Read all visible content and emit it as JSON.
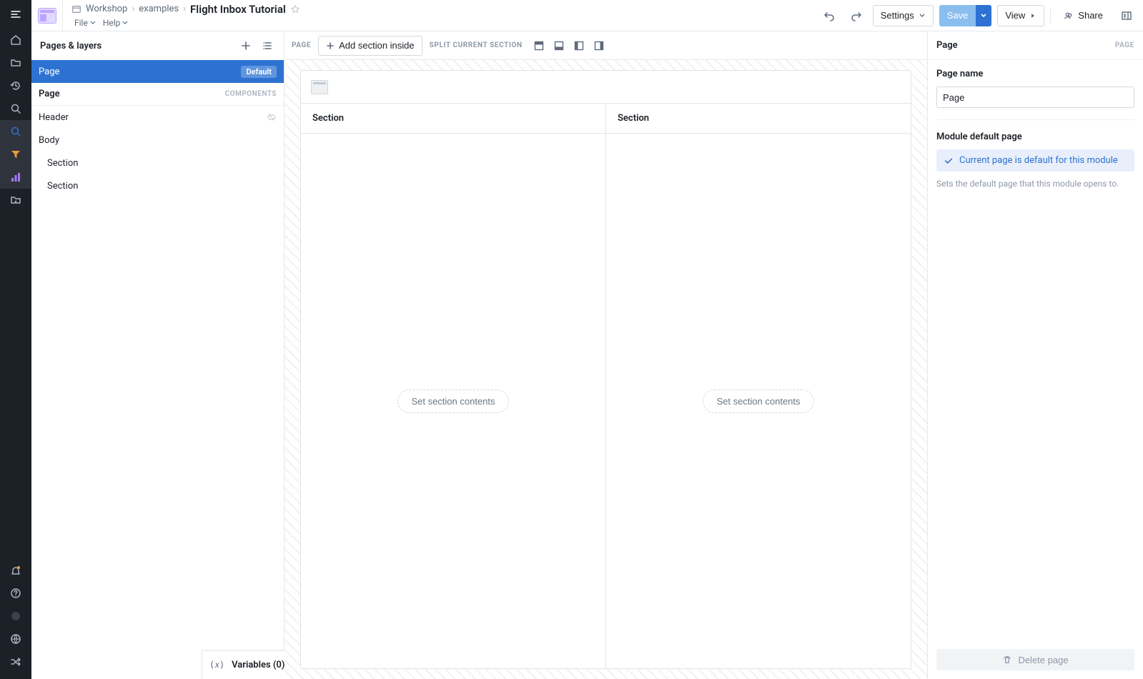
{
  "breadcrumb": {
    "items": [
      "Workshop",
      "examples"
    ],
    "current": "Flight Inbox Tutorial"
  },
  "menubar": {
    "file": "File",
    "help": "Help"
  },
  "toolbar": {
    "settings": "Settings",
    "save": "Save",
    "view": "View",
    "share": "Share"
  },
  "left": {
    "title": "Pages & layers",
    "tree": {
      "page_selected": "Page",
      "default_badge": "Default",
      "page2": "Page",
      "components_tag": "COMPONENTS",
      "header": "Header",
      "body": "Body",
      "section1": "Section",
      "section2": "Section"
    },
    "variables_label": "Variables (0)"
  },
  "canvas": {
    "page_label": "PAGE",
    "add_section_inside": "Add section inside",
    "split_label": "SPLIT CURRENT SECTION",
    "section_heading": "Section",
    "set_section_contents": "Set section contents"
  },
  "right": {
    "title": "Page",
    "side_tag": "PAGE",
    "page_name_label": "Page name",
    "page_name_value": "Page",
    "module_default_label": "Module default page",
    "callout": "Current page is default for this module",
    "hint": "Sets the default page that this module opens to.",
    "delete": "Delete page"
  }
}
